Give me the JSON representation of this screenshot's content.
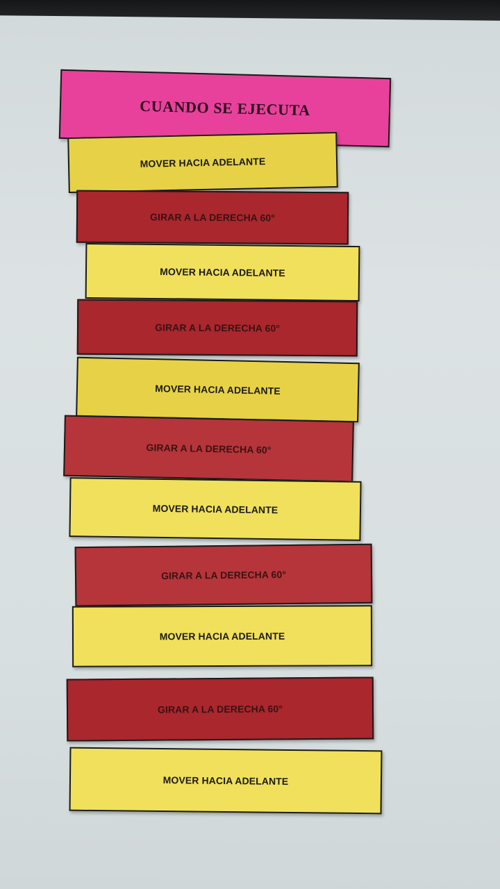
{
  "scene": {
    "description_alt": "Tarjetas de programación sobre papel"
  },
  "blocks": [
    {
      "kind": "start",
      "label": "CUANDO SE EJECUTA"
    },
    {
      "kind": "move",
      "label": "MOVER HACIA ADELANTE"
    },
    {
      "kind": "turn",
      "label": "GIRAR A LA DERECHA 60°"
    },
    {
      "kind": "move",
      "label": "MOVER HACIA ADELANTE"
    },
    {
      "kind": "turn",
      "label": "GIRAR A LA DERECHA 60°"
    },
    {
      "kind": "move",
      "label": "MOVER HACIA ADELANTE"
    },
    {
      "kind": "turn",
      "label": "GIRAR A LA DERECHA 60°"
    },
    {
      "kind": "move",
      "label": "MOVER HACIA ADELANTE"
    },
    {
      "kind": "turn",
      "label": "GIRAR A LA DERECHA 60°"
    },
    {
      "kind": "move",
      "label": "MOVER HACIA ADELANTE"
    },
    {
      "kind": "turn",
      "label": "GIRAR A LA DERECHA 60°"
    },
    {
      "kind": "move",
      "label": "MOVER HACIA ADELANTE"
    }
  ],
  "colors": {
    "start": "#e8419c",
    "move": "#e7d247",
    "turn": "#a9272d",
    "paper": "#d8dfe0"
  }
}
